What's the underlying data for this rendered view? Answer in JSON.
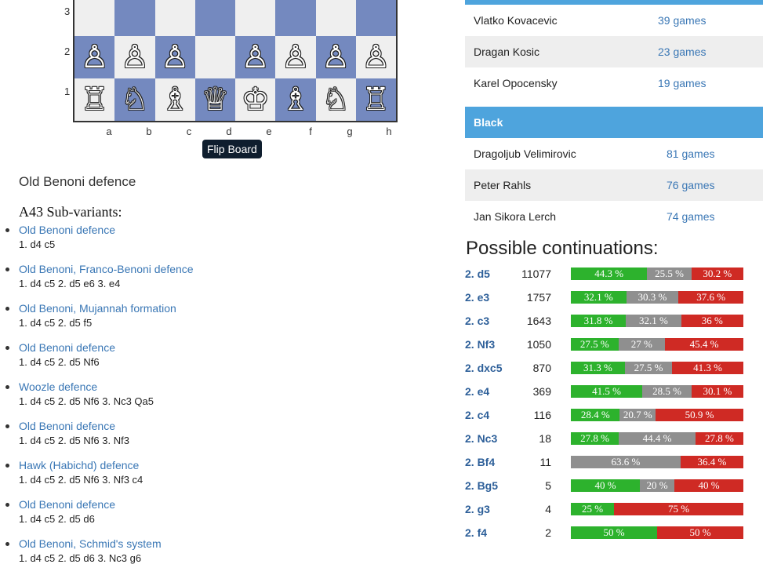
{
  "board": {
    "ranks_shown": [
      "3",
      "2",
      "1"
    ],
    "files": [
      "a",
      "b",
      "c",
      "d",
      "e",
      "f",
      "g",
      "h"
    ],
    "rows": [
      [
        "",
        "",
        "",
        "",
        "",
        "",
        "",
        ""
      ],
      [
        "♙",
        "♙",
        "♙",
        "",
        "♙",
        "♙",
        "♙",
        "♙"
      ],
      [
        "♖",
        "♘",
        "♗",
        "♕",
        "♔",
        "♗",
        "♘",
        "♖"
      ]
    ],
    "flip_label": "Flip Board",
    "dark_color": "#7489bf",
    "light_color": "#efefef"
  },
  "opening": {
    "name": "Old Benoni defence",
    "subvariants_title": "A43 Sub-variants:",
    "subvariants": [
      {
        "name": "Old Benoni defence",
        "moves": "1. d4 c5"
      },
      {
        "name": "Old Benoni, Franco-Benoni defence",
        "moves": "1. d4 c5 2. d5 e6 3. e4"
      },
      {
        "name": "Old Benoni, Mujannah formation",
        "moves": "1. d4 c5 2. d5 f5"
      },
      {
        "name": "Old Benoni defence",
        "moves": "1. d4 c5 2. d5 Nf6"
      },
      {
        "name": "Woozle defence",
        "moves": "1. d4 c5 2. d5 Nf6 3. Nc3 Qa5"
      },
      {
        "name": "Old Benoni defence",
        "moves": "1. d4 c5 2. d5 Nf6 3. Nf3"
      },
      {
        "name": "Hawk (Habichd) defence",
        "moves": "1. d4 c5 2. d5 Nf6 3. Nf3 c4"
      },
      {
        "name": "Old Benoni defence",
        "moves": "1. d4 c5 2. d5 d6"
      },
      {
        "name": "Old Benoni, Schmid's system",
        "moves": "1. d4 c5 2. d5 d6 3. Nc3 g6"
      }
    ]
  },
  "white_players": [
    {
      "name": "Vlatko Kovacevic",
      "games": "39 games"
    },
    {
      "name": "Dragan Kosic",
      "games": "23 games"
    },
    {
      "name": "Karel Opocensky",
      "games": "19 games"
    }
  ],
  "black_header": "Black",
  "black_players": [
    {
      "name": "Dragoljub Velimirovic",
      "games": "81 games"
    },
    {
      "name": "Peter Rahls",
      "games": "76 games"
    },
    {
      "name": "Jan Sikora Lerch",
      "games": "74 games"
    }
  ],
  "continuations": {
    "title": "Possible continuations:",
    "colors": {
      "white_win": "#2db22d",
      "draw": "#8f8f8f",
      "black_win": "#cf2a24"
    },
    "rows": [
      {
        "move": "2. d5",
        "count": "11077",
        "w": 44.3,
        "d": 25.5,
        "b": 30.2,
        "wl": "44.3 %",
        "dl": "25.5 %",
        "bl": "30.2 %"
      },
      {
        "move": "2. e3",
        "count": "1757",
        "w": 32.1,
        "d": 30.3,
        "b": 37.6,
        "wl": "32.1 %",
        "dl": "30.3 %",
        "bl": "37.6 %"
      },
      {
        "move": "2. c3",
        "count": "1643",
        "w": 31.8,
        "d": 32.1,
        "b": 36.0,
        "wl": "31.8 %",
        "dl": "32.1 %",
        "bl": "36 %"
      },
      {
        "move": "2. Nf3",
        "count": "1050",
        "w": 27.5,
        "d": 27.0,
        "b": 45.4,
        "wl": "27.5 %",
        "dl": "27 %",
        "bl": "45.4 %"
      },
      {
        "move": "2. dxc5",
        "count": "870",
        "w": 31.3,
        "d": 27.5,
        "b": 41.3,
        "wl": "31.3 %",
        "dl": "27.5 %",
        "bl": "41.3 %"
      },
      {
        "move": "2. e4",
        "count": "369",
        "w": 41.5,
        "d": 28.5,
        "b": 30.1,
        "wl": "41.5 %",
        "dl": "28.5 %",
        "bl": "30.1 %"
      },
      {
        "move": "2. c4",
        "count": "116",
        "w": 28.4,
        "d": 20.7,
        "b": 50.9,
        "wl": "28.4 %",
        "dl": "20.7 %",
        "bl": "50.9 %"
      },
      {
        "move": "2. Nc3",
        "count": "18",
        "w": 27.8,
        "d": 44.4,
        "b": 27.8,
        "wl": "27.8 %",
        "dl": "44.4 %",
        "bl": "27.8 %"
      },
      {
        "move": "2. Bf4",
        "count": "11",
        "w": 0,
        "d": 63.6,
        "b": 36.4,
        "wl": "",
        "dl": "63.6 %",
        "bl": "36.4 %"
      },
      {
        "move": "2. Bg5",
        "count": "5",
        "w": 40,
        "d": 20,
        "b": 40,
        "wl": "40 %",
        "dl": "20 %",
        "bl": "40 %"
      },
      {
        "move": "2. g3",
        "count": "4",
        "w": 25,
        "d": 0,
        "b": 75,
        "wl": "25 %",
        "dl": "",
        "bl": "75 %"
      },
      {
        "move": "2. f4",
        "count": "2",
        "w": 50,
        "d": 0,
        "b": 50,
        "wl": "50 %",
        "dl": "",
        "bl": "50 %"
      }
    ]
  }
}
